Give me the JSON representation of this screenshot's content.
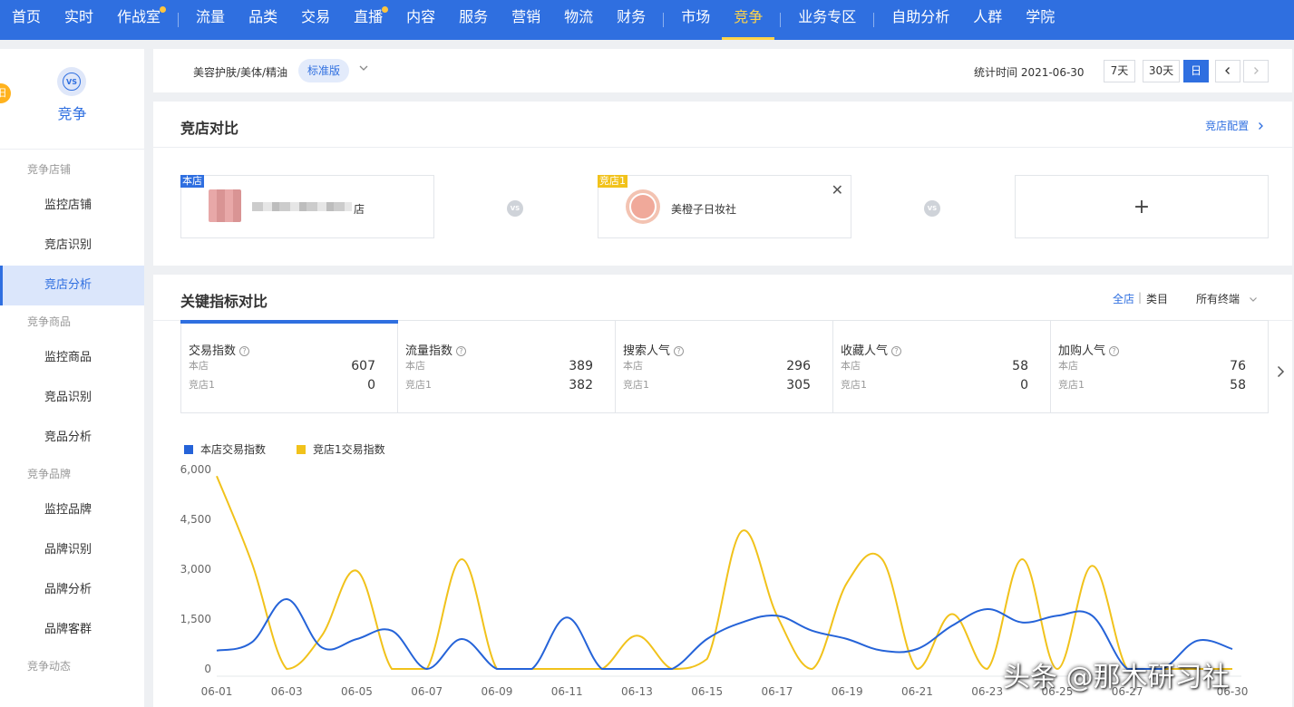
{
  "topnav": {
    "items": [
      {
        "label": "首页"
      },
      {
        "label": "实时"
      },
      {
        "label": "作战室",
        "dot": true
      },
      {
        "label": "流量"
      },
      {
        "label": "品类"
      },
      {
        "label": "交易"
      },
      {
        "label": "直播",
        "dot": true
      },
      {
        "label": "内容"
      },
      {
        "label": "服务"
      },
      {
        "label": "营销"
      },
      {
        "label": "物流"
      },
      {
        "label": "财务"
      },
      {
        "label": "市场"
      },
      {
        "label": "竞争",
        "active": true
      },
      {
        "label": "业务专区"
      },
      {
        "label": "自助分析"
      },
      {
        "label": "人群"
      },
      {
        "label": "学院"
      }
    ],
    "accent": "#2f6fe0",
    "active_color": "#ffd44a"
  },
  "sidebar": {
    "badge": "旧",
    "title": "竞争",
    "groups": [
      {
        "label": "竞争店铺",
        "items": [
          {
            "label": "监控店铺"
          },
          {
            "label": "竞店识别"
          },
          {
            "label": "竞店分析",
            "active": true
          }
        ]
      },
      {
        "label": "竞争商品",
        "items": [
          {
            "label": "监控商品"
          },
          {
            "label": "竞品识别"
          },
          {
            "label": "竞品分析"
          }
        ]
      },
      {
        "label": "竞争品牌",
        "items": [
          {
            "label": "监控品牌"
          },
          {
            "label": "品牌识别"
          },
          {
            "label": "品牌分析"
          },
          {
            "label": "品牌客群"
          }
        ]
      },
      {
        "label": "竞争动态",
        "items": []
      }
    ]
  },
  "filter": {
    "category": "美容护肤/美体/精油",
    "edition": "标准版",
    "stat_time": "统计时间 2021-06-30",
    "buttons": [
      "7天",
      "30天",
      "日"
    ],
    "active_button": "日"
  },
  "compare": {
    "title": "竞店对比",
    "config_link": "竞店配置",
    "my_tag": "本店",
    "my_shop_suffix": "店",
    "rival_tag": "竞店1",
    "rival_name": "美橙子日妆社",
    "vs": "VS",
    "add": "+"
  },
  "metrics": {
    "title": "关键指标对比",
    "range_all": "全店",
    "range_sep": "|",
    "range_cat": "类目",
    "terminal": "所有终端",
    "row_labels": [
      "本店",
      "竞店1"
    ],
    "items": [
      {
        "name": "交易指数",
        "mine": "607",
        "rival": "0",
        "active": true
      },
      {
        "name": "流量指数",
        "mine": "389",
        "rival": "382"
      },
      {
        "name": "搜索人气",
        "mine": "296",
        "rival": "305"
      },
      {
        "name": "收藏人气",
        "mine": "58",
        "rival": "0"
      },
      {
        "name": "加购人气",
        "mine": "76",
        "rival": "58"
      }
    ]
  },
  "chart_data": {
    "type": "line",
    "x": [
      "06-01",
      "06-02",
      "06-03",
      "06-04",
      "06-05",
      "06-06",
      "06-07",
      "06-08",
      "06-09",
      "06-10",
      "06-11",
      "06-12",
      "06-13",
      "06-14",
      "06-15",
      "06-16",
      "06-17",
      "06-18",
      "06-19",
      "06-20",
      "06-21",
      "06-22",
      "06-23",
      "06-24",
      "06-25",
      "06-26",
      "06-27",
      "06-28",
      "06-29",
      "06-30"
    ],
    "tick_labels": [
      "06-01",
      "06-03",
      "06-05",
      "06-07",
      "06-09",
      "06-11",
      "06-13",
      "06-15",
      "06-17",
      "06-19",
      "06-21",
      "06-23",
      "06-25",
      "06-27",
      "06-30"
    ],
    "ylim": [
      0,
      6000
    ],
    "yticks": [
      0,
      1500,
      3000,
      4500,
      6000
    ],
    "ytick_labels": [
      "0",
      "1,500",
      "3,000",
      "4,500",
      "6,000"
    ],
    "grid": false,
    "legend_position": "top-left",
    "series": [
      {
        "name": "本店交易指数",
        "color": "#2563d8",
        "values": [
          550,
          800,
          2100,
          650,
          900,
          1150,
          0,
          900,
          0,
          0,
          1550,
          0,
          0,
          0,
          900,
          1400,
          1600,
          1150,
          900,
          550,
          600,
          1300,
          1800,
          1400,
          1600,
          1600,
          0,
          0,
          850,
          600
        ]
      },
      {
        "name": "竞店1交易指数",
        "color": "#f1c21b",
        "values": [
          5800,
          3200,
          0,
          1000,
          2950,
          0,
          0,
          3300,
          0,
          0,
          0,
          0,
          1000,
          0,
          300,
          4150,
          1600,
          0,
          2600,
          3300,
          0,
          1650,
          0,
          3300,
          0,
          3100,
          0,
          0,
          0,
          0
        ]
      }
    ]
  },
  "watermark": "头条 @那木研习社"
}
